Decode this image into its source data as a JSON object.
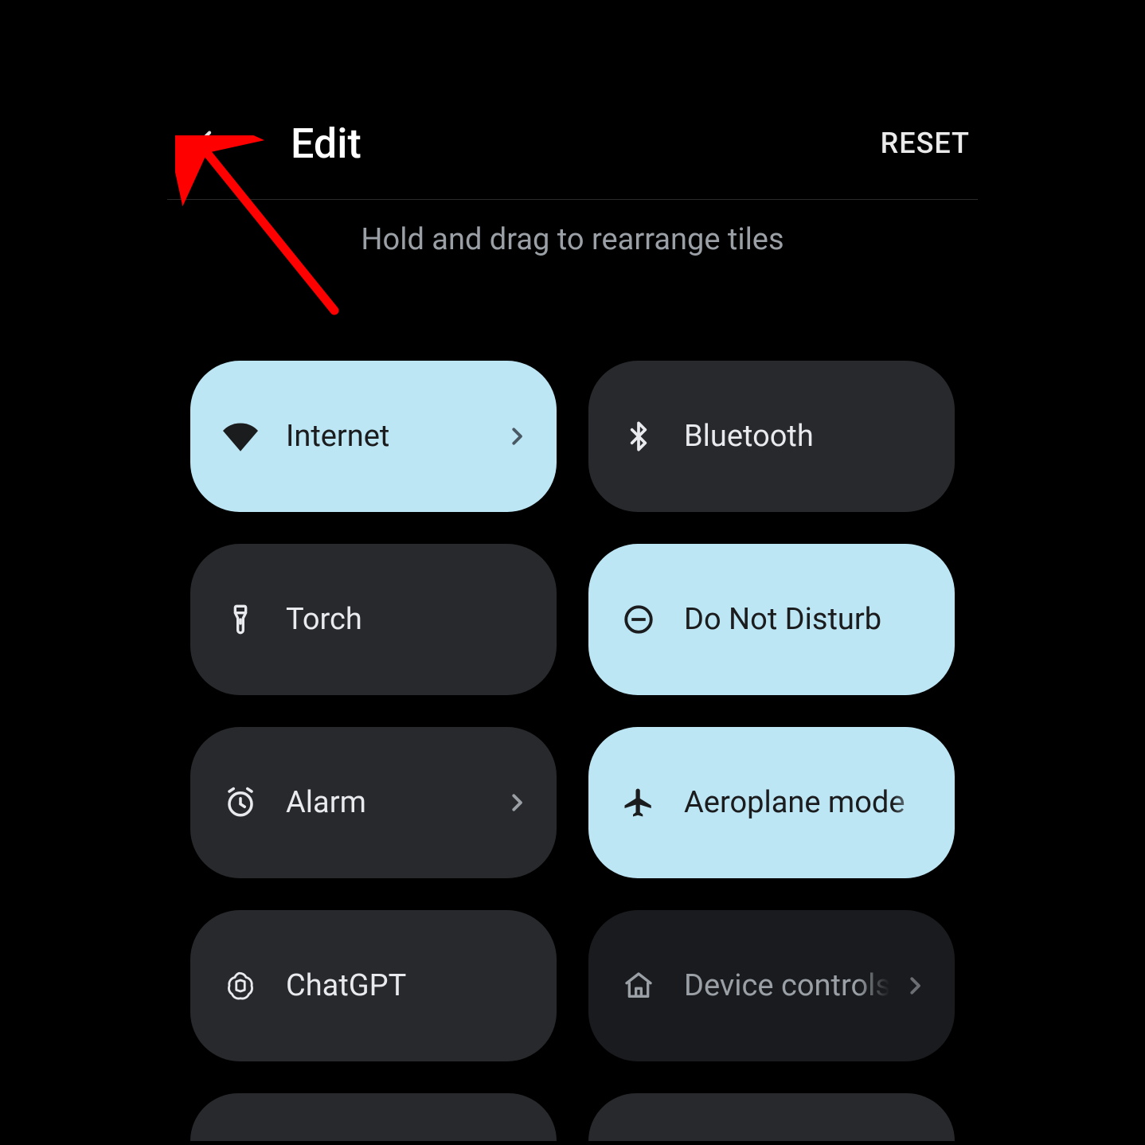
{
  "header": {
    "title": "Edit",
    "reset_label": "RESET"
  },
  "subtitle": "Hold and drag to rearrange tiles",
  "tiles": [
    {
      "id": "internet",
      "label": "Internet",
      "icon": "wifi",
      "active": true,
      "chevron": true,
      "dim": false
    },
    {
      "id": "bluetooth",
      "label": "Bluetooth",
      "icon": "bluetooth",
      "active": false,
      "chevron": false,
      "dim": false
    },
    {
      "id": "torch",
      "label": "Torch",
      "icon": "torch",
      "active": false,
      "chevron": false,
      "dim": false
    },
    {
      "id": "dnd",
      "label": "Do Not Disturb",
      "icon": "dnd",
      "active": true,
      "chevron": false,
      "dim": false
    },
    {
      "id": "alarm",
      "label": "Alarm",
      "icon": "alarm",
      "active": false,
      "chevron": true,
      "dim": false
    },
    {
      "id": "aeroplane",
      "label": "Aeroplane mode",
      "icon": "airplane",
      "active": true,
      "chevron": false,
      "dim": false
    },
    {
      "id": "chatgpt",
      "label": "ChatGPT",
      "icon": "chatgpt",
      "active": false,
      "chevron": false,
      "dim": false
    },
    {
      "id": "device",
      "label": "Device controls",
      "icon": "home",
      "active": false,
      "chevron": true,
      "dim": true
    }
  ],
  "colors": {
    "background": "#000000",
    "tile_dark": "#28292c",
    "tile_light": "#bde6f4",
    "tile_dim": "#1a1b1e",
    "annotation_arrow": "#ff0000"
  },
  "annotation": {
    "arrow_points_to": "back-button"
  }
}
